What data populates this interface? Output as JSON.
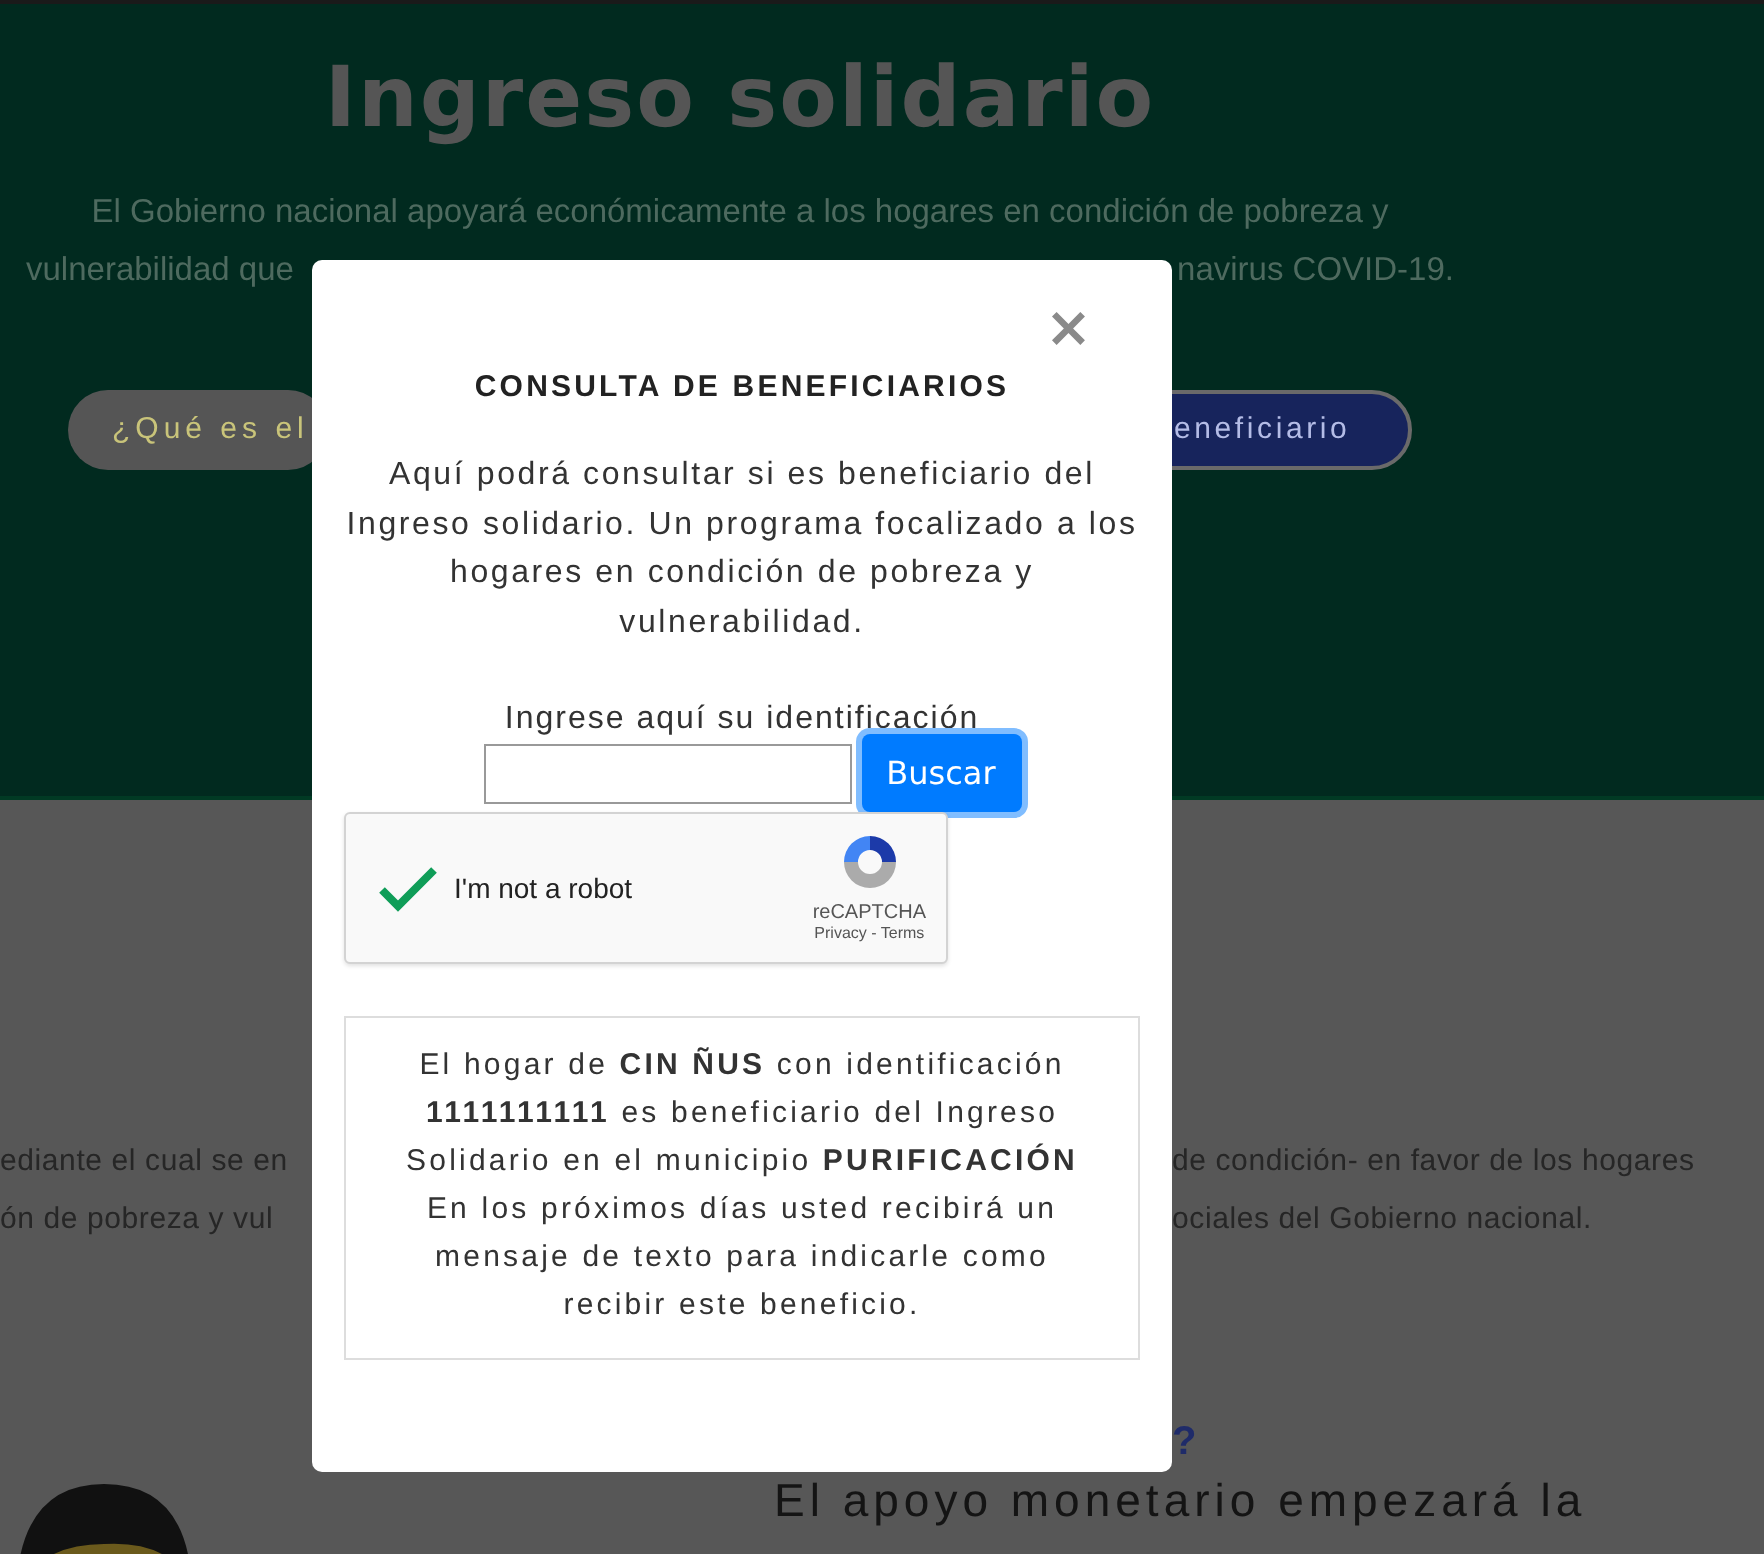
{
  "hero": {
    "title": "Ingreso solidario",
    "intro_line_1": "El Gobierno nacional apoyará económicamente a los hogares en condición de pobreza y",
    "intro_line_2_left": "vulnerabilidad que",
    "intro_line_2_right": "navirus COVID-19.",
    "buttons": [
      {
        "label": "¿Qué es el",
        "kind": "light"
      },
      {
        "label": "eneficiario",
        "kind": "dark"
      }
    ]
  },
  "body": {
    "rows": [
      {
        "left": "ediante el cual se en",
        "right": "de condición- en favor de los hogares"
      },
      {
        "left": "ón de pobreza y vul",
        "right": "ociales del Gobierno nacional."
      }
    ],
    "question_mark": "?",
    "lead": "El apoyo monetario empezará la"
  },
  "modal": {
    "close": "×",
    "title": "CONSULTA DE BENEFICIARIOS",
    "description": "Aquí podrá consultar si es beneficiario del Ingreso solidario. Un programa focalizado a los hogares en condición de pobreza y vulnerabilidad.",
    "id_label": "Ingrese aquí su identificación",
    "search_button": "Buscar",
    "captcha": {
      "checked": true,
      "label": "I'm not a robot",
      "brand": "reCAPTCHA",
      "links": "Privacy - Terms"
    },
    "result": [
      "El hogar de **CIN ÑUS** con identificación **1111111111** es beneficiario del Ingreso Solidario en el municipio **PURIFICACIÓN**",
      "En los próximos días usted recibirá un mensaje de texto para indicarle como recibir este beneficio."
    ]
  }
}
